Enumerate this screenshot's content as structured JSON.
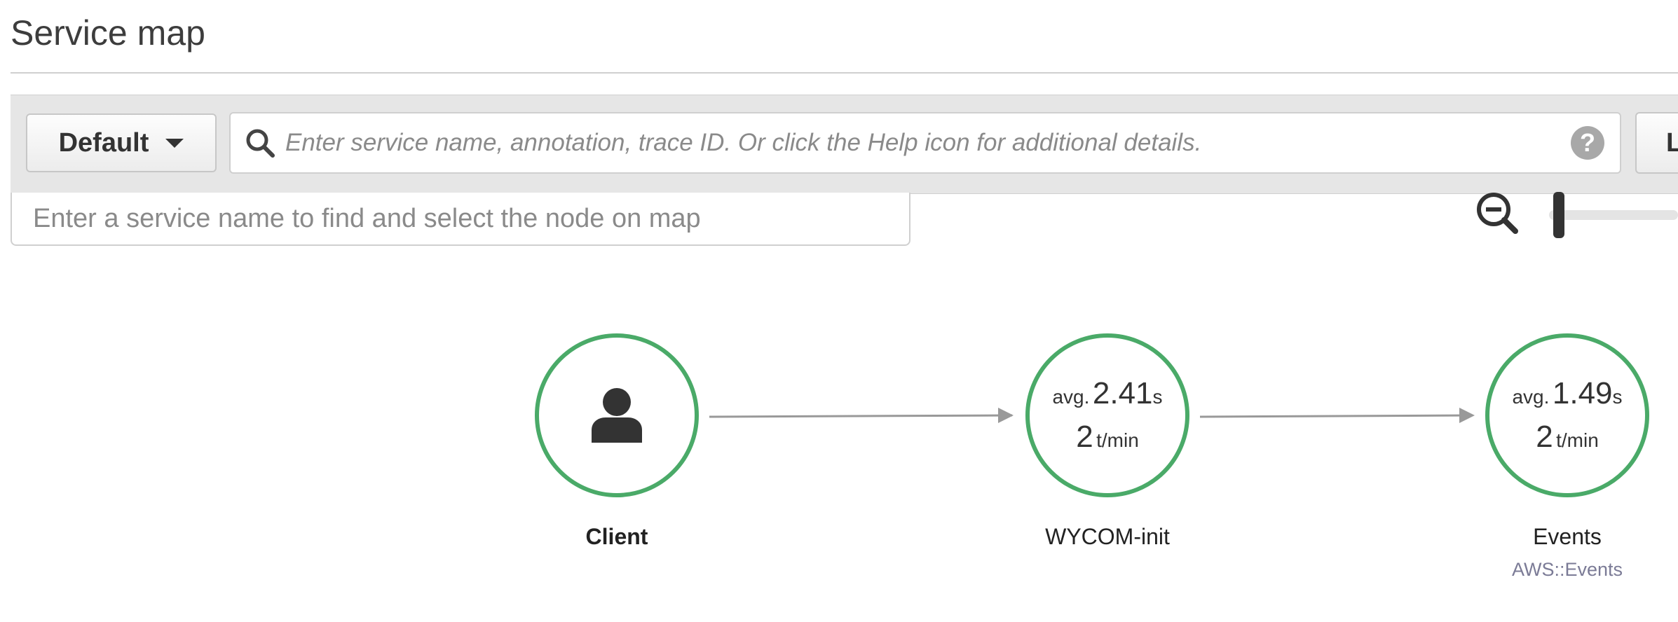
{
  "page": {
    "title": "Service map"
  },
  "filter_bar": {
    "group_button_label": "Default",
    "search_placeholder": "Enter service name, annotation, trace ID. Or click the Help icon for additional details.",
    "help_icon_label": "?",
    "right_button_label": "L"
  },
  "node_finder": {
    "placeholder": "Enter a service name to find and select the node on map"
  },
  "colors": {
    "healthy_node": "#4aaa68",
    "edge": "#999999"
  },
  "nodes": [
    {
      "name": "Client",
      "icon": "user-icon"
    },
    {
      "name": "WYCOM-init",
      "avg_prefix": "avg.",
      "avg_value": "2.41",
      "avg_unit": "s",
      "rate_value": "2",
      "rate_unit": "t/min"
    },
    {
      "name": "Events",
      "type": "AWS::Events",
      "avg_prefix": "avg.",
      "avg_value": "1.49",
      "avg_unit": "s",
      "rate_value": "2",
      "rate_unit": "t/min"
    }
  ]
}
